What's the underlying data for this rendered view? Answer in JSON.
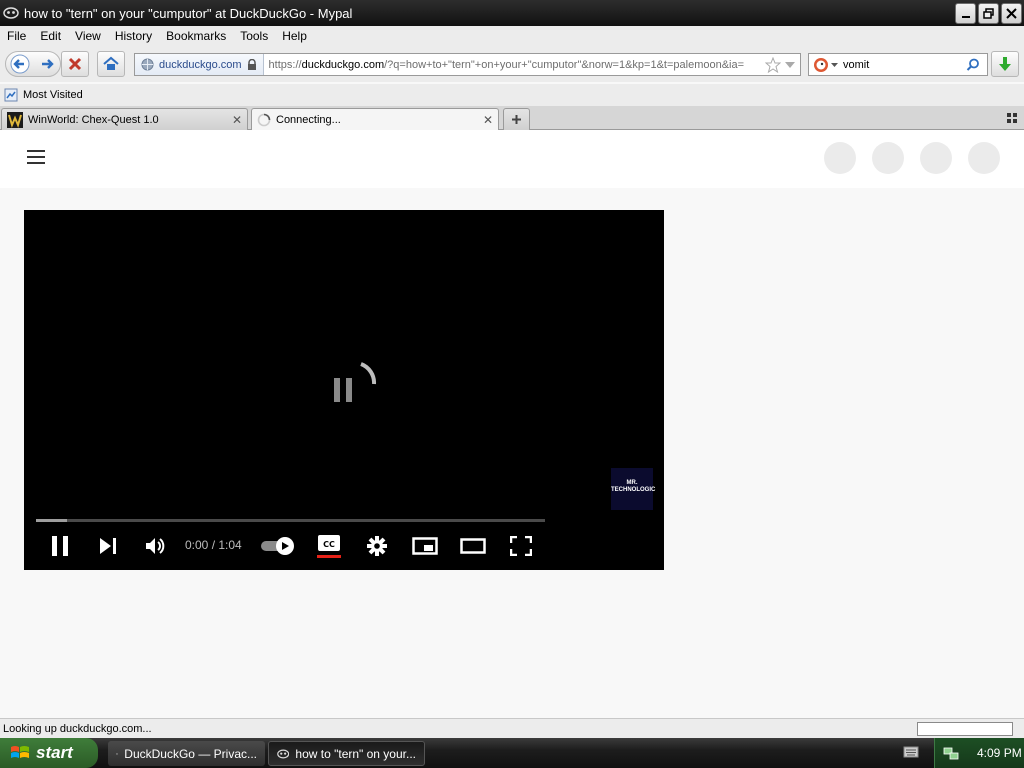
{
  "window": {
    "title": "how to \"tern\" on your \"cumputor\" at DuckDuckGo - Mypal"
  },
  "menu": [
    "File",
    "Edit",
    "View",
    "History",
    "Bookmarks",
    "Tools",
    "Help"
  ],
  "navbar": {
    "identity_domain": "duckduckgo.com",
    "url_scheme": "https://",
    "url_host": "duckduckgo.com",
    "url_path": "/?q=how+to+\"tern\"+on+your+\"cumputor\"&norw=1&kp=1&t=palemoon&ia=",
    "search_query": "vomit"
  },
  "bookmarks": {
    "most_visited": "Most Visited"
  },
  "tabs": [
    {
      "title": "WinWorld: Chex-Quest 1.0"
    },
    {
      "title": "Connecting..."
    }
  ],
  "player": {
    "time": "0:00 / 1:04",
    "watermark_line1": "MR.",
    "watermark_line2": "TECHNOLOGIC",
    "progress_loaded": 0.06
  },
  "status": {
    "text": "Looking up duckduckgo.com..."
  },
  "taskbar": {
    "start_label": "start",
    "tasks": [
      {
        "title": "DuckDuckGo — Privac..."
      },
      {
        "title": "how to \"tern\" on your..."
      }
    ],
    "clock": "4:09 PM"
  },
  "colors": {
    "cc_underline": "#e62117",
    "stop_red": "#c0392b",
    "nav_blue": "#2f6fc0",
    "download_green": "#2eaa2e"
  }
}
